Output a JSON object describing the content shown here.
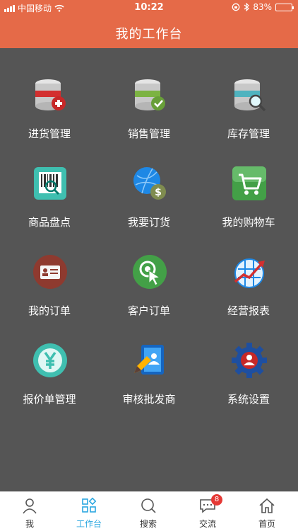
{
  "status_bar": {
    "carrier": "中国移动",
    "time": "10:22",
    "battery": "83%",
    "battery_level": 0.83
  },
  "header": {
    "title": "我的工作台"
  },
  "tiles": [
    {
      "label": "进货管理",
      "icon": "db-add-icon"
    },
    {
      "label": "销售管理",
      "icon": "db-check-icon"
    },
    {
      "label": "库存管理",
      "icon": "db-search-icon"
    },
    {
      "label": "商品盘点",
      "icon": "barcode-scan-icon"
    },
    {
      "label": "我要订货",
      "icon": "globe-dollar-icon"
    },
    {
      "label": "我的购物车",
      "icon": "shopping-cart-icon"
    },
    {
      "label": "我的订单",
      "icon": "id-card-icon"
    },
    {
      "label": "客户订单",
      "icon": "touch-click-icon"
    },
    {
      "label": "经营报表",
      "icon": "chart-arrow-icon"
    },
    {
      "label": "报价单管理",
      "icon": "yen-icon"
    },
    {
      "label": "审核批发商",
      "icon": "address-book-edit-icon"
    },
    {
      "label": "系统设置",
      "icon": "gear-user-icon"
    }
  ],
  "tabbar": {
    "tabs": [
      {
        "label": "我",
        "icon": "person-icon"
      },
      {
        "label": "工作台",
        "icon": "workbench-icon"
      },
      {
        "label": "搜索",
        "icon": "search-icon"
      },
      {
        "label": "交流",
        "icon": "chat-icon",
        "badge": "8"
      },
      {
        "label": "首页",
        "icon": "home-icon"
      }
    ],
    "active_index": 1
  },
  "colors": {
    "header": "#E56A48",
    "background": "#555555",
    "active_tab": "#2BA7E0"
  }
}
